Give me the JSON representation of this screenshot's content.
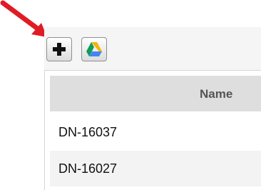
{
  "toolbar": {
    "add_icon": "plus-icon",
    "drive_icon": "google-drive-icon"
  },
  "annotation": {
    "arrow_color": "#e01b24"
  },
  "grid": {
    "columns": [
      "Name"
    ],
    "rows": [
      {
        "name": "DN-16037"
      },
      {
        "name": "DN-16027"
      }
    ]
  }
}
